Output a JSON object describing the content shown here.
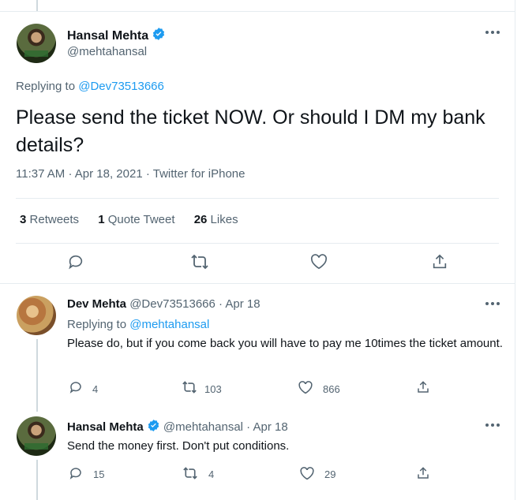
{
  "main_tweet": {
    "author_name": "Hansal Mehta",
    "author_handle": "@mehtahansal",
    "replying_prefix": "Replying to",
    "replying_to": "@Dev73513666",
    "text": "Please send the ticket NOW. Or should I DM my bank details?",
    "time": "11:37 AM",
    "date": "Apr 18, 2021",
    "source": "Twitter for iPhone",
    "separator": "·",
    "stats": {
      "retweets_count": "3",
      "retweets_label": "Retweets",
      "quote_count": "1",
      "quote_label": "Quote Tweet",
      "likes_count": "26",
      "likes_label": "Likes"
    }
  },
  "reply1": {
    "author_name": "Dev Mehta",
    "author_handle": "@Dev73513666",
    "date": "Apr 18",
    "separator": "·",
    "replying_prefix": "Replying to",
    "replying_to": "@mehtahansal",
    "text": "Please do, but if you come back you will have to pay me 10times the ticket amount.",
    "replies": "4",
    "retweets": "103",
    "likes": "866"
  },
  "reply2": {
    "author_name": "Hansal Mehta",
    "author_handle": "@mehtahansal",
    "date": "Apr 18",
    "separator": "·",
    "text": "Send the money first. Don't put conditions.",
    "replies": "15",
    "retweets": "4",
    "likes": "29"
  },
  "colors": {
    "accent": "#1d9bf0",
    "secondary_text": "#536471",
    "border": "#e6ecf0"
  },
  "icons": [
    "verified-badge-icon",
    "more-icon",
    "reply-icon",
    "retweet-icon",
    "like-icon",
    "share-icon"
  ]
}
